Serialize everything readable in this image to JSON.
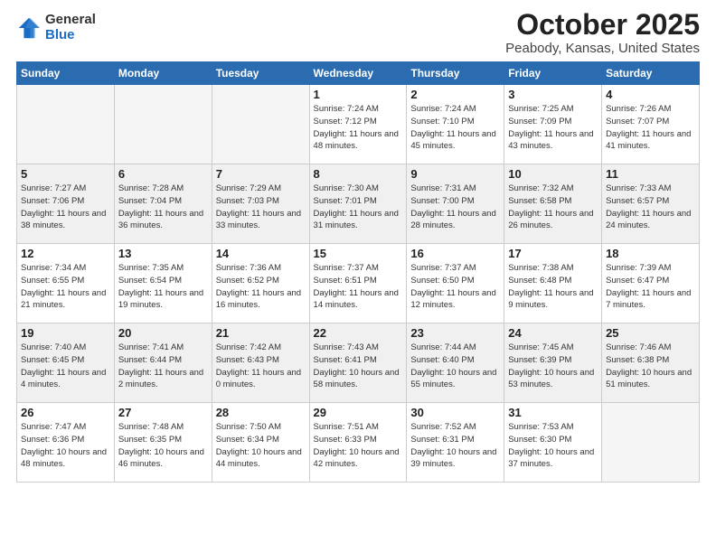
{
  "logo": {
    "general": "General",
    "blue": "Blue"
  },
  "title": "October 2025",
  "location": "Peabody, Kansas, United States",
  "days_of_week": [
    "Sunday",
    "Monday",
    "Tuesday",
    "Wednesday",
    "Thursday",
    "Friday",
    "Saturday"
  ],
  "weeks": [
    [
      {
        "day": "",
        "empty": true
      },
      {
        "day": "",
        "empty": true
      },
      {
        "day": "",
        "empty": true
      },
      {
        "day": "1",
        "sunrise": "7:24 AM",
        "sunset": "7:12 PM",
        "daylight": "11 hours and 48 minutes."
      },
      {
        "day": "2",
        "sunrise": "7:24 AM",
        "sunset": "7:10 PM",
        "daylight": "11 hours and 45 minutes."
      },
      {
        "day": "3",
        "sunrise": "7:25 AM",
        "sunset": "7:09 PM",
        "daylight": "11 hours and 43 minutes."
      },
      {
        "day": "4",
        "sunrise": "7:26 AM",
        "sunset": "7:07 PM",
        "daylight": "11 hours and 41 minutes."
      }
    ],
    [
      {
        "day": "5",
        "sunrise": "7:27 AM",
        "sunset": "7:06 PM",
        "daylight": "11 hours and 38 minutes."
      },
      {
        "day": "6",
        "sunrise": "7:28 AM",
        "sunset": "7:04 PM",
        "daylight": "11 hours and 36 minutes."
      },
      {
        "day": "7",
        "sunrise": "7:29 AM",
        "sunset": "7:03 PM",
        "daylight": "11 hours and 33 minutes."
      },
      {
        "day": "8",
        "sunrise": "7:30 AM",
        "sunset": "7:01 PM",
        "daylight": "11 hours and 31 minutes."
      },
      {
        "day": "9",
        "sunrise": "7:31 AM",
        "sunset": "7:00 PM",
        "daylight": "11 hours and 28 minutes."
      },
      {
        "day": "10",
        "sunrise": "7:32 AM",
        "sunset": "6:58 PM",
        "daylight": "11 hours and 26 minutes."
      },
      {
        "day": "11",
        "sunrise": "7:33 AM",
        "sunset": "6:57 PM",
        "daylight": "11 hours and 24 minutes."
      }
    ],
    [
      {
        "day": "12",
        "sunrise": "7:34 AM",
        "sunset": "6:55 PM",
        "daylight": "11 hours and 21 minutes."
      },
      {
        "day": "13",
        "sunrise": "7:35 AM",
        "sunset": "6:54 PM",
        "daylight": "11 hours and 19 minutes."
      },
      {
        "day": "14",
        "sunrise": "7:36 AM",
        "sunset": "6:52 PM",
        "daylight": "11 hours and 16 minutes."
      },
      {
        "day": "15",
        "sunrise": "7:37 AM",
        "sunset": "6:51 PM",
        "daylight": "11 hours and 14 minutes."
      },
      {
        "day": "16",
        "sunrise": "7:37 AM",
        "sunset": "6:50 PM",
        "daylight": "11 hours and 12 minutes."
      },
      {
        "day": "17",
        "sunrise": "7:38 AM",
        "sunset": "6:48 PM",
        "daylight": "11 hours and 9 minutes."
      },
      {
        "day": "18",
        "sunrise": "7:39 AM",
        "sunset": "6:47 PM",
        "daylight": "11 hours and 7 minutes."
      }
    ],
    [
      {
        "day": "19",
        "sunrise": "7:40 AM",
        "sunset": "6:45 PM",
        "daylight": "11 hours and 4 minutes."
      },
      {
        "day": "20",
        "sunrise": "7:41 AM",
        "sunset": "6:44 PM",
        "daylight": "11 hours and 2 minutes."
      },
      {
        "day": "21",
        "sunrise": "7:42 AM",
        "sunset": "6:43 PM",
        "daylight": "11 hours and 0 minutes."
      },
      {
        "day": "22",
        "sunrise": "7:43 AM",
        "sunset": "6:41 PM",
        "daylight": "10 hours and 58 minutes."
      },
      {
        "day": "23",
        "sunrise": "7:44 AM",
        "sunset": "6:40 PM",
        "daylight": "10 hours and 55 minutes."
      },
      {
        "day": "24",
        "sunrise": "7:45 AM",
        "sunset": "6:39 PM",
        "daylight": "10 hours and 53 minutes."
      },
      {
        "day": "25",
        "sunrise": "7:46 AM",
        "sunset": "6:38 PM",
        "daylight": "10 hours and 51 minutes."
      }
    ],
    [
      {
        "day": "26",
        "sunrise": "7:47 AM",
        "sunset": "6:36 PM",
        "daylight": "10 hours and 48 minutes."
      },
      {
        "day": "27",
        "sunrise": "7:48 AM",
        "sunset": "6:35 PM",
        "daylight": "10 hours and 46 minutes."
      },
      {
        "day": "28",
        "sunrise": "7:50 AM",
        "sunset": "6:34 PM",
        "daylight": "10 hours and 44 minutes."
      },
      {
        "day": "29",
        "sunrise": "7:51 AM",
        "sunset": "6:33 PM",
        "daylight": "10 hours and 42 minutes."
      },
      {
        "day": "30",
        "sunrise": "7:52 AM",
        "sunset": "6:31 PM",
        "daylight": "10 hours and 39 minutes."
      },
      {
        "day": "31",
        "sunrise": "7:53 AM",
        "sunset": "6:30 PM",
        "daylight": "10 hours and 37 minutes."
      },
      {
        "day": "",
        "empty": true
      }
    ]
  ],
  "labels": {
    "sunrise": "Sunrise:",
    "sunset": "Sunset:",
    "daylight": "Daylight:"
  }
}
